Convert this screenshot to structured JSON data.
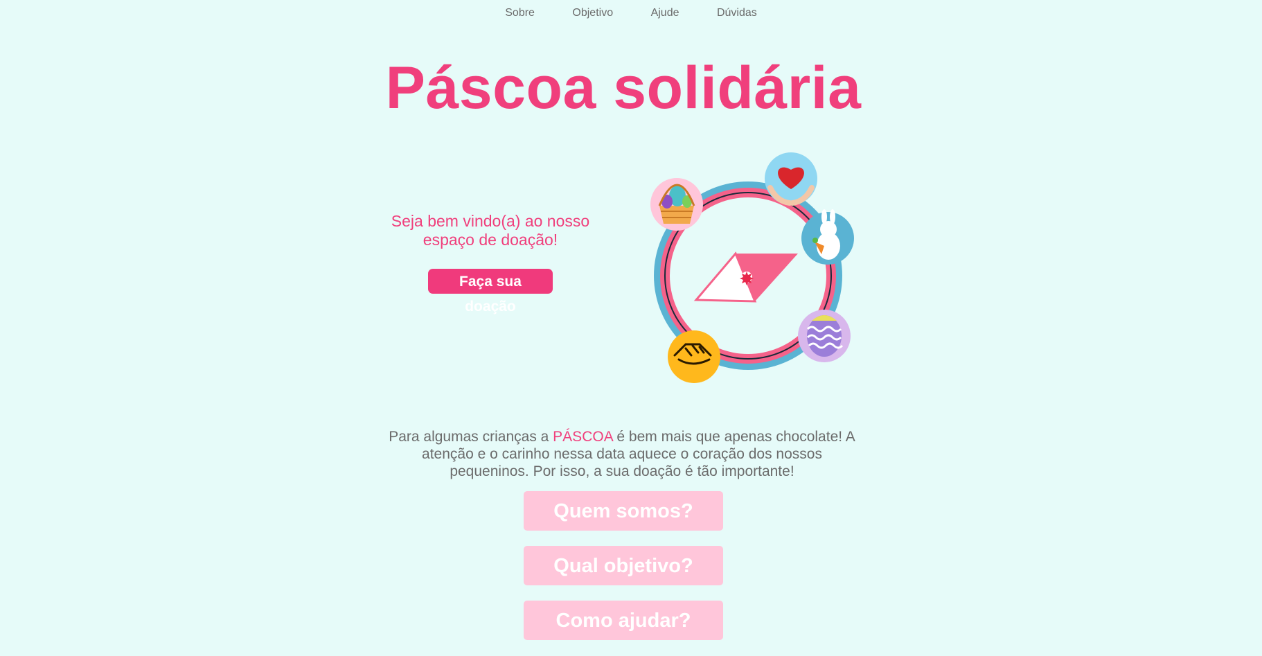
{
  "nav": {
    "items": [
      {
        "label": "Sobre"
      },
      {
        "label": "Objetivo"
      },
      {
        "label": "Ajude"
      },
      {
        "label": "Dúvidas"
      }
    ]
  },
  "hero": {
    "title": "Páscoa solidária",
    "welcome": "Seja bem vindo(a) ao nosso espaço de doação!",
    "donate_button": "Faça sua doação"
  },
  "intro": {
    "before": "Para algumas crianças a ",
    "highlight": "PÁSCOA",
    "after": " é bem mais que apenas chocolate! A atenção e o carinho nessa data aquece o coração dos nossos pequeninos. Por isso, a sua doação é tão importante!"
  },
  "sections": [
    {
      "label": "Quem somos?"
    },
    {
      "label": "Qual objetivo?"
    },
    {
      "label": "Como ajudar?"
    }
  ],
  "colors": {
    "background": "#e6fbf9",
    "accent": "#f03f7c",
    "pill": "#ffc6da",
    "text_muted": "#6b6b6b"
  },
  "icons": [
    "easter-basket-icon",
    "heart-hands-icon",
    "bunny-icon",
    "easter-egg-icon",
    "handshake-icon",
    "envelope-icon"
  ]
}
